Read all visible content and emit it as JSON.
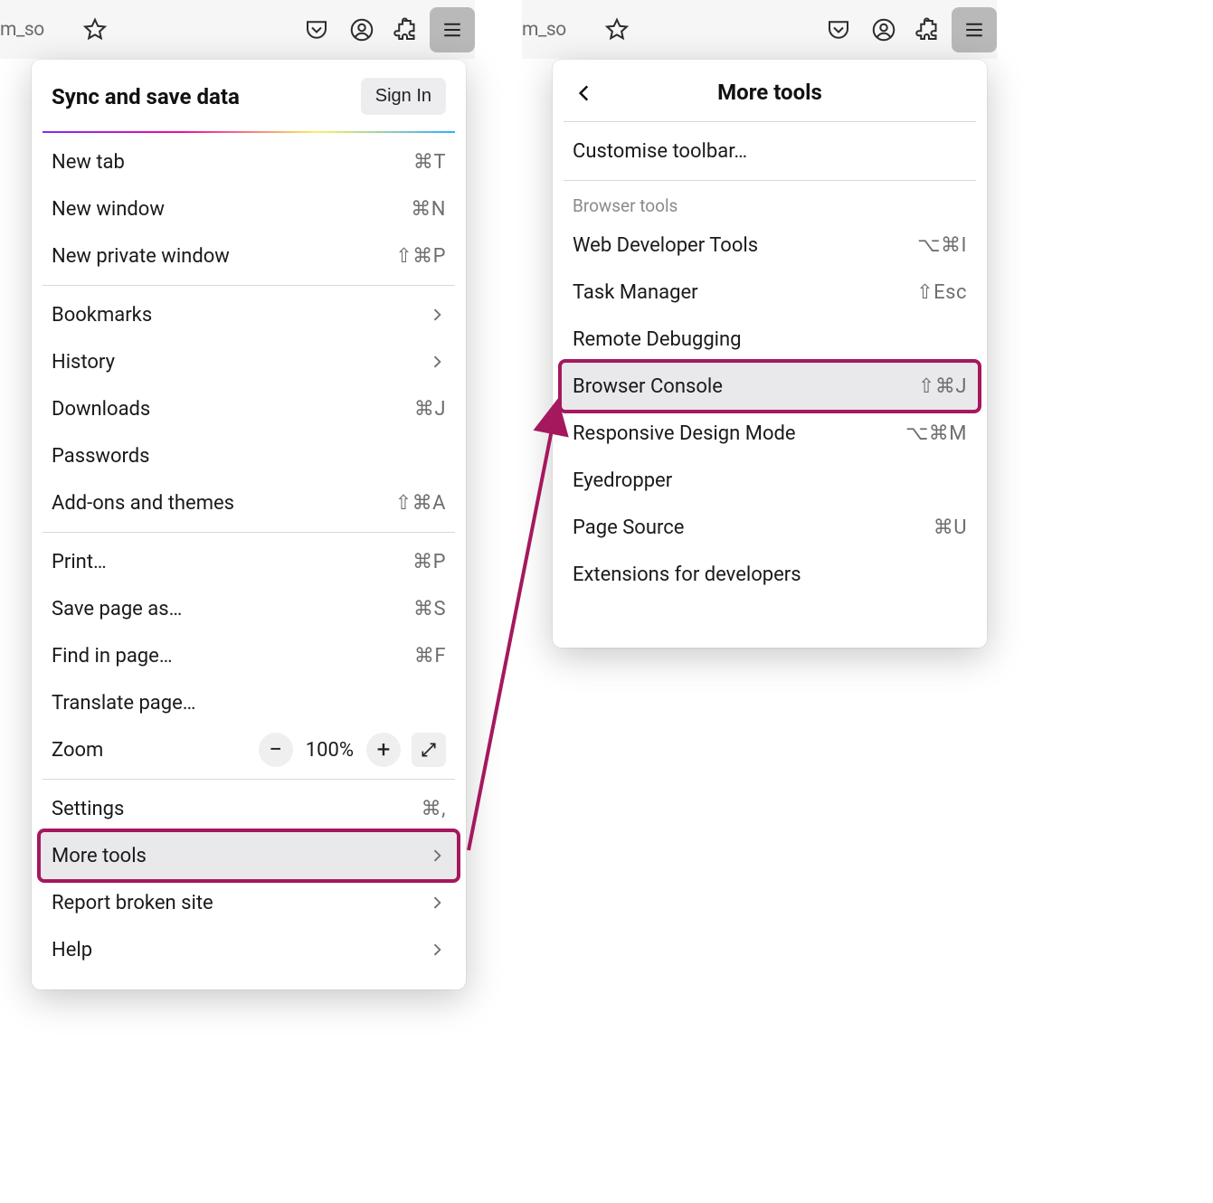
{
  "toolbar": {
    "tab_stub": "m_so"
  },
  "menu1": {
    "sync_title": "Sync and save data",
    "signin": "Sign In",
    "items_top": [
      {
        "label": "New tab",
        "shortcut": "⌘T"
      },
      {
        "label": "New window",
        "shortcut": "⌘N"
      },
      {
        "label": "New private window",
        "shortcut": "⇧⌘P"
      }
    ],
    "items_nav": [
      {
        "label": "Bookmarks",
        "arrow": true
      },
      {
        "label": "History",
        "arrow": true
      },
      {
        "label": "Downloads",
        "shortcut": "⌘J"
      },
      {
        "label": "Passwords"
      },
      {
        "label": "Add-ons and themes",
        "shortcut": "⇧⌘A"
      }
    ],
    "items_page": [
      {
        "label": "Print…",
        "shortcut": "⌘P"
      },
      {
        "label": "Save page as…",
        "shortcut": "⌘S"
      },
      {
        "label": "Find in page…",
        "shortcut": "⌘F"
      },
      {
        "label": "Translate page…"
      }
    ],
    "zoom": {
      "label": "Zoom",
      "pct": "100%"
    },
    "items_bottom": [
      {
        "label": "Settings",
        "shortcut": "⌘,"
      },
      {
        "label": "More tools",
        "arrow": true,
        "hl": true
      },
      {
        "label": "Report broken site",
        "arrow": true
      },
      {
        "label": "Help",
        "arrow": true
      }
    ]
  },
  "menu2": {
    "title": "More tools",
    "customise": "Customise toolbar…",
    "section": "Browser tools",
    "items": [
      {
        "label": "Web Developer Tools",
        "shortcut": "⌥⌘I"
      },
      {
        "label": "Task Manager",
        "shortcut": "⇧Esc"
      },
      {
        "label": "Remote Debugging"
      },
      {
        "label": "Browser Console",
        "shortcut": "⇧⌘J",
        "hl": true
      },
      {
        "label": "Responsive Design Mode",
        "shortcut": "⌥⌘M"
      },
      {
        "label": "Eyedropper"
      },
      {
        "label": "Page Source",
        "shortcut": "⌘U"
      },
      {
        "label": "Extensions for developers"
      }
    ]
  }
}
